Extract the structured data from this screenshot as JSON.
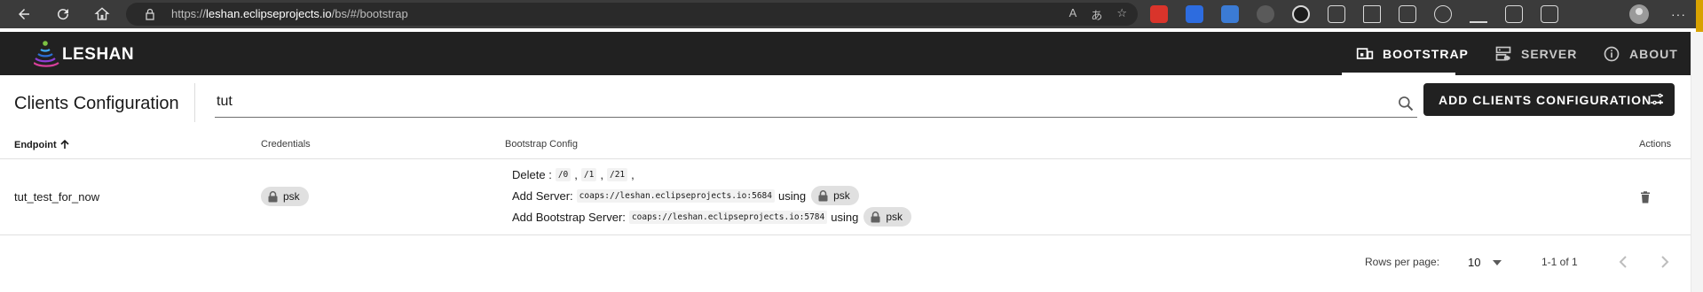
{
  "browser": {
    "url_prefix": "https://",
    "url_host": "leshan.eclipseprojects.io",
    "url_path": "/bs/#/bootstrap",
    "read_aloud": "A",
    "translate": "あ"
  },
  "app": {
    "logo_text": "LESHAN",
    "tabs": [
      {
        "label": "BOOTSTRAP",
        "icon": "bootstrap-icon",
        "active": true
      },
      {
        "label": "SERVER",
        "icon": "server-icon",
        "active": false
      },
      {
        "label": "ABOUT",
        "icon": "info-icon",
        "active": false
      }
    ]
  },
  "toolbar": {
    "title": "Clients Configuration",
    "search_value": "tut",
    "add_button": "ADD CLIENTS CONFIGURATION"
  },
  "table": {
    "headers": {
      "endpoint": "Endpoint",
      "credentials": "Credentials",
      "bootstrap_config": "Bootstrap Config",
      "actions": "Actions"
    },
    "rows": [
      {
        "endpoint": "tut_test_for_now",
        "credentials": "psk",
        "config": {
          "delete_label": "Delete :",
          "delete_paths": [
            "/0",
            "/1",
            "/21"
          ],
          "add_server_label": "Add Server:",
          "server_uri": "coaps://leshan.eclipseprojects.io:5684",
          "using": "using",
          "server_security": "psk",
          "add_bs_label": "Add Bootstrap Server:",
          "bs_uri": "coaps://leshan.eclipseprojects.io:5784",
          "bs_security": "psk"
        }
      }
    ]
  },
  "pagination": {
    "rows_label": "Rows per page:",
    "rows_value": "10",
    "range": "1-1 of 1"
  },
  "colors": {
    "appbar": "#212121",
    "chip": "#e0e0e0",
    "browser": "#3b3b3b"
  }
}
